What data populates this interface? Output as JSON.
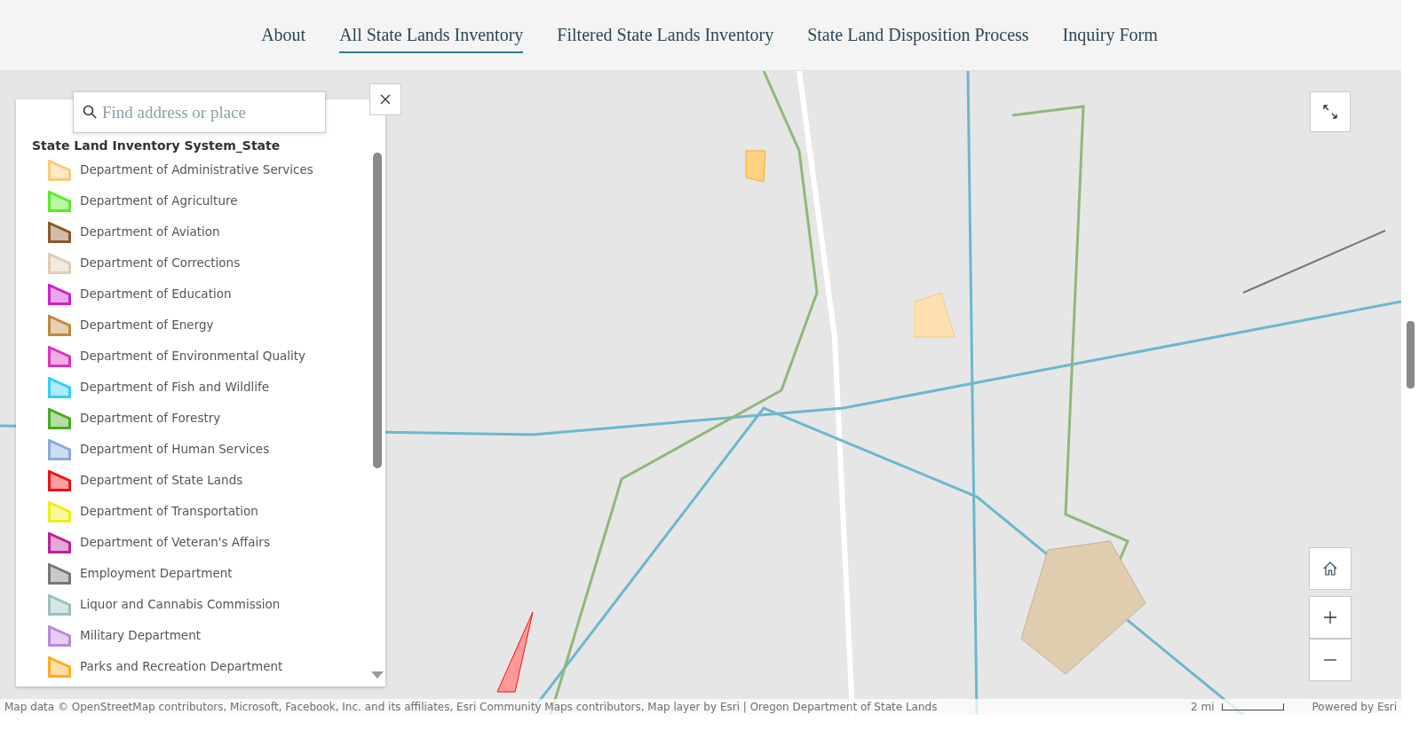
{
  "nav": [
    {
      "label": "About",
      "selected": false
    },
    {
      "label": "All State Lands Inventory",
      "selected": true
    },
    {
      "label": "Filtered State Lands Inventory",
      "selected": false
    },
    {
      "label": "State Land Disposition Process",
      "selected": false
    },
    {
      "label": "Inquiry Form",
      "selected": false
    }
  ],
  "search": {
    "placeholder": "Find address or place"
  },
  "legend": {
    "title": "State Land Inventory System_State",
    "items": [
      {
        "label": "Department of Administrative Services",
        "color": "#fcc97a"
      },
      {
        "label": "Department of Agriculture",
        "color": "#55ee22"
      },
      {
        "label": "Department of Aviation",
        "color": "#8b5a2b"
      },
      {
        "label": "Department of Corrections",
        "color": "#e0cdb0"
      },
      {
        "label": "Department of Education",
        "color": "#cc22cc"
      },
      {
        "label": "Department of Energy",
        "color": "#c08840"
      },
      {
        "label": "Department of Environmental Quality",
        "color": "#dd33bb"
      },
      {
        "label": "Department of Fish and Wildlife",
        "color": "#33ccff"
      },
      {
        "label": "Department of Forestry",
        "color": "#44aa22"
      },
      {
        "label": "Department of Human Services",
        "color": "#88aadd"
      },
      {
        "label": "Department of State Lands",
        "color": "#ee1111"
      },
      {
        "label": "Department of Transportation",
        "color": "#eeee11"
      },
      {
        "label": "Department of Veteran's Affairs",
        "color": "#bb2299"
      },
      {
        "label": "Employment Department",
        "color": "#777777"
      },
      {
        "label": "Liquor and Cannabis Commission",
        "color": "#99c0c0"
      },
      {
        "label": "Military Department",
        "color": "#bb88dd"
      },
      {
        "label": "Parks and Recreation Department",
        "color": "#ffaa22"
      }
    ]
  },
  "attribution": {
    "text": "Map data © OpenStreetMap contributors, Microsoft, Facebook, Inc. and its affiliates, Esri Community Maps contributors, Map layer by Esri | Oregon Department of State Lands",
    "scale": "2 mi",
    "powered_by": "Powered by Esri"
  }
}
